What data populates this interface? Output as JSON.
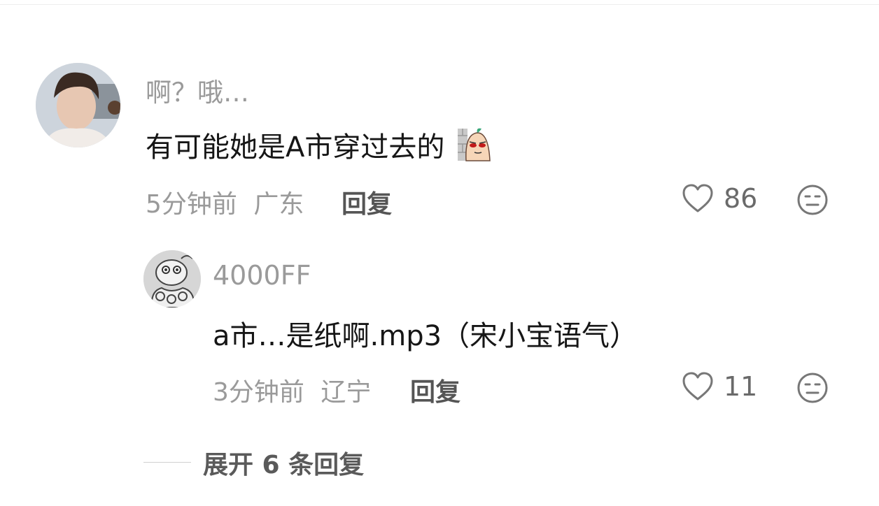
{
  "comment": {
    "username": "啊？哦…",
    "text": "有可能她是A市穿过去的",
    "emoji": "peeking-potato-sticker",
    "time": "5分钟前",
    "location": "广东",
    "reply_label": "回复",
    "likes": "86"
  },
  "reply": {
    "username": "4000FF",
    "text": "a市…是纸啊.mp3（宋小宝语气）",
    "time": "3分钟前",
    "location": "辽宁",
    "reply_label": "回复",
    "likes": "11"
  },
  "expand": {
    "label": "展开 6 条回复"
  },
  "icons": {
    "like": "heart-outline-icon",
    "reaction": "meh-face-icon"
  },
  "colors": {
    "text": "#161616",
    "secondary": "#9a9a9a",
    "reply_button": "#555555"
  }
}
